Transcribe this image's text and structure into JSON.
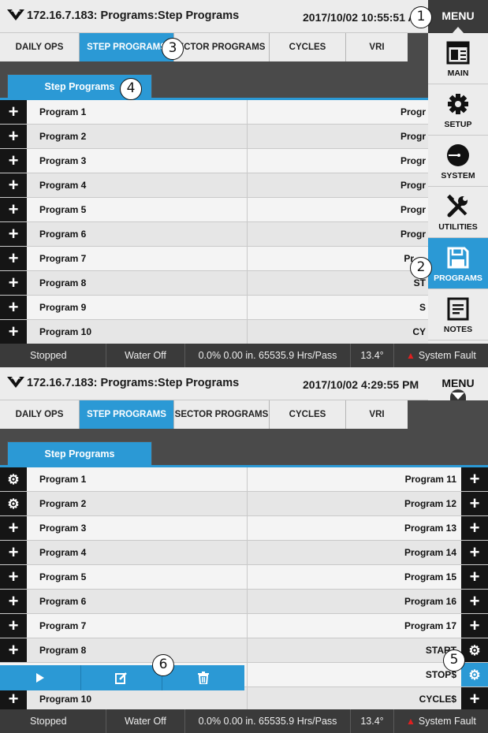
{
  "colors": {
    "accent": "#2b99d5",
    "dark": "#151515",
    "status_bg": "#3a3a3a",
    "fault": "#e02020"
  },
  "panel1": {
    "title": "172.16.7.183: Programs:Step Programs",
    "datetime": "2017/10/02 10:55:51 A",
    "menu_label": "MENU",
    "tabs": [
      "DAILY OPS",
      "STEP PROGRAMS",
      "SECTOR PROGRAMS",
      "CYCLES",
      "VRI"
    ],
    "tab2_visible": "ECTOR PROGRAMS",
    "subtab": "Step Programs",
    "rows": [
      {
        "left": "Program 1",
        "right": "Progr"
      },
      {
        "left": "Program 2",
        "right": "Progr"
      },
      {
        "left": "Program 3",
        "right": "Progr"
      },
      {
        "left": "Program 4",
        "right": "Progr"
      },
      {
        "left": "Program 5",
        "right": "Progr"
      },
      {
        "left": "Program 6",
        "right": "Progr"
      },
      {
        "left": "Program 7",
        "right": "Pr"
      },
      {
        "left": "Program 8",
        "right": "ST"
      },
      {
        "left": "Program 9",
        "right": "S"
      },
      {
        "left": "Program 10",
        "right": "CY"
      }
    ],
    "menu_items": [
      {
        "label": "MAIN",
        "icon": "main-icon"
      },
      {
        "label": "SETUP",
        "icon": "gear-icon"
      },
      {
        "label": "SYSTEM",
        "icon": "system-icon"
      },
      {
        "label": "UTILITIES",
        "icon": "tools-icon"
      },
      {
        "label": "PROGRAMS",
        "icon": "save-icon"
      },
      {
        "label": "NOTES",
        "icon": "notes-icon"
      }
    ],
    "status": {
      "state": "Stopped",
      "water": "Water Off",
      "rate": "0.0%  0.00 in.  65535.9 Hrs/Pass",
      "angle": "13.4°",
      "fault": "System Fault"
    }
  },
  "panel2": {
    "title": "172.16.7.183: Programs:Step Programs",
    "datetime": "2017/10/02 4:29:55 PM",
    "menu_label": "MENU",
    "tabs": [
      "DAILY OPS",
      "STEP PROGRAMS",
      "SECTOR PROGRAMS",
      "CYCLES",
      "VRI"
    ],
    "subtab": "Step Programs",
    "rows": [
      {
        "left": "Program 1",
        "right": "Program 11",
        "left_icon": "gear",
        "right_icon": "plus"
      },
      {
        "left": "Program 2",
        "right": "Program 12",
        "left_icon": "gear",
        "right_icon": "plus"
      },
      {
        "left": "Program 3",
        "right": "Program 13",
        "left_icon": "plus",
        "right_icon": "plus"
      },
      {
        "left": "Program 4",
        "right": "Program 14",
        "left_icon": "plus",
        "right_icon": "plus"
      },
      {
        "left": "Program 5",
        "right": "Program 15",
        "left_icon": "plus",
        "right_icon": "plus"
      },
      {
        "left": "Program 6",
        "right": "Program 16",
        "left_icon": "plus",
        "right_icon": "plus"
      },
      {
        "left": "Program 7",
        "right": "Program 17",
        "left_icon": "plus",
        "right_icon": "plus"
      },
      {
        "left": "Program 8",
        "right": "START",
        "left_icon": "plus",
        "right_icon": "gear"
      },
      {
        "left": "",
        "right": "STOP$",
        "left_icon": "none",
        "right_icon": "gear-blue"
      },
      {
        "left": "Program 10",
        "right": "CYCLE$",
        "left_icon": "plus",
        "right_icon": "plus"
      }
    ],
    "actions": [
      "play-icon",
      "edit-icon",
      "trash-icon"
    ],
    "status": {
      "state": "Stopped",
      "water": "Water Off",
      "rate": "0.0%  0.00 in.  65535.9 Hrs/Pass",
      "angle": "13.4°",
      "fault": "System Fault"
    }
  },
  "callouts": [
    "1",
    "2",
    "3",
    "4",
    "5",
    "6"
  ]
}
